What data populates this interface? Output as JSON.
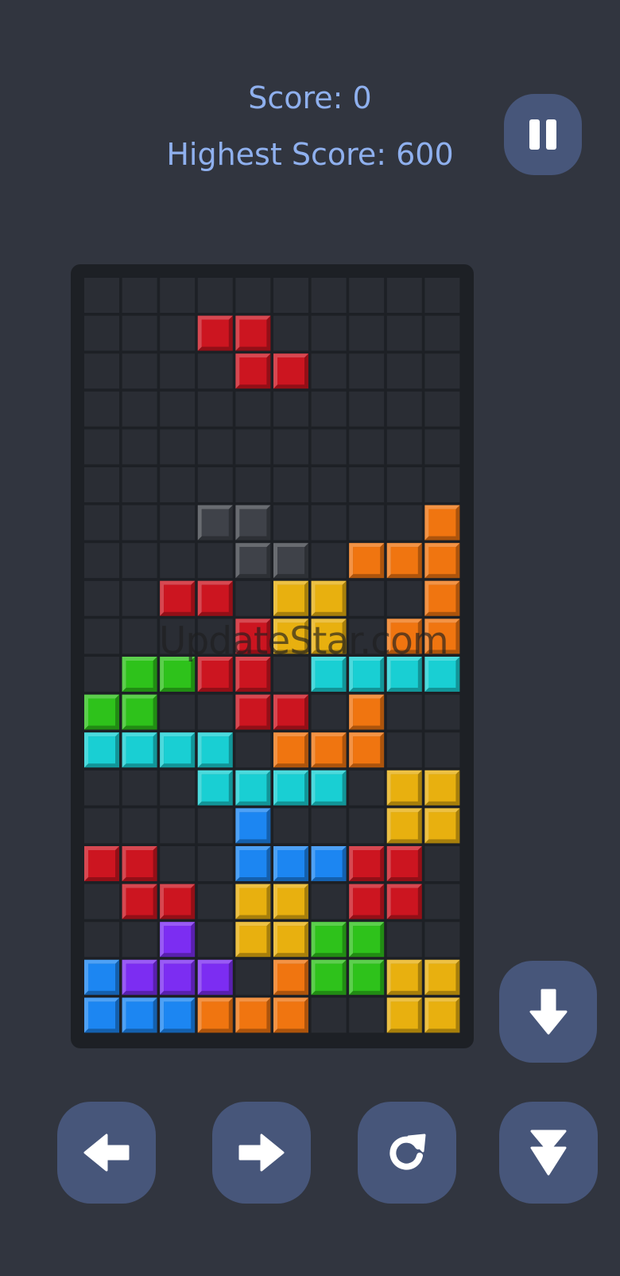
{
  "header": {
    "score_text": "Score: 0",
    "high_score_text": "Highest Score: 600"
  },
  "controls": {
    "pause_icon": "pause-icon",
    "soft_drop_icon": "arrow-down-icon",
    "move_left_icon": "arrow-left-icon",
    "move_right_icon": "arrow-right-icon",
    "rotate_icon": "rotate-icon",
    "hard_drop_icon": "hard-drop-icon"
  },
  "watermark": "UpdateStar.com",
  "colors": {
    "background": "#31353f",
    "board": "#1d2025",
    "empty_cell": "#2a2d34",
    "button": "#47567a",
    "score_text": "#8fb0ee",
    "R": "#cc1520",
    "O": "#f07510",
    "Y": "#e8b00f",
    "G": "#2ec21b",
    "C": "#19cfd3",
    "B": "#1c86f2",
    "P": "#7c2df2",
    "S": "#3f4249"
  },
  "board": {
    "columns": 10,
    "rows": 20,
    "cells": [
      "..........",
      "...RR.....",
      "....RR....",
      "..........",
      "..........",
      "..........",
      "...SS....O",
      "....SS.OOO",
      "..RR.YY..O",
      "....RYY.OO",
      ".GGRR.CCCC",
      "GG..RR.O..",
      "CCCC.OOO..",
      "...CCCC.YY",
      "....B...YY",
      "RR..BBBRR.",
      ".RR.YY.RR.",
      "..P.YYGG..",
      "BPPP.OGGYY",
      "BBBOOO..YY"
    ]
  }
}
